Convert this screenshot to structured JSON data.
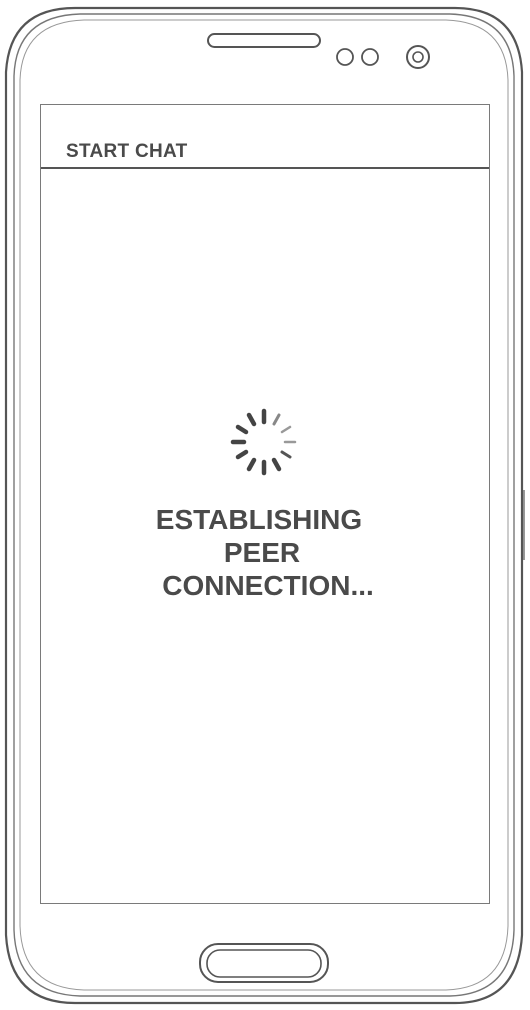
{
  "app": {
    "title": "START CHAT"
  },
  "status": {
    "lines": [
      "ESTABLISHING",
      "PEER",
      "CONNECTION..."
    ]
  },
  "icons": {
    "loading": "loading-spinner-icon",
    "earpiece": "earpiece-speaker-icon",
    "sensors": "proximity-sensor-icon",
    "camera": "front-camera-icon",
    "home": "home-button-icon"
  },
  "colors": {
    "outline": "#555555",
    "text": "#4a4a4a",
    "background": "#ffffff"
  }
}
